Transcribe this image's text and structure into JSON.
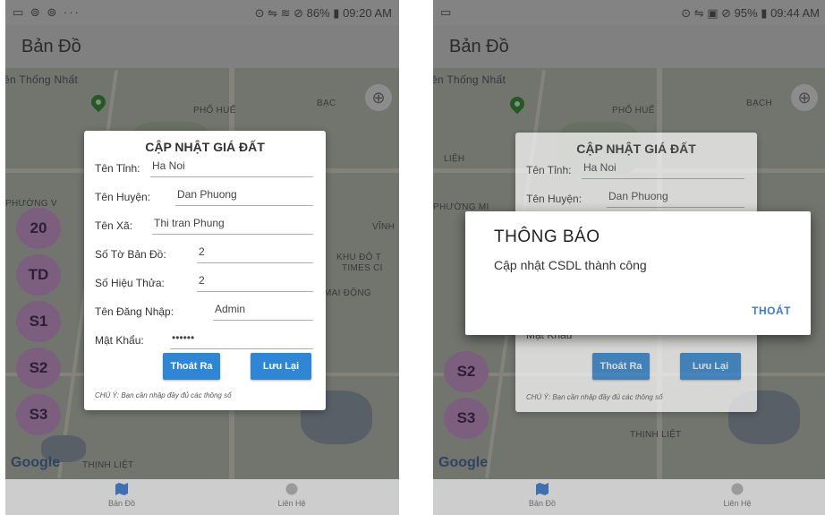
{
  "left_screen": {
    "status_bar": {
      "left_icons": "▭ ⊚ ⊚ ···",
      "right_text": "⊙ ⇋ ≋ ⊘ 86% ▮ 09:20 AM"
    },
    "app_title": "Bản Đồ",
    "map_labels": [
      "ên Thống Nhất",
      "PHỐ HUẾ",
      "BẠC",
      "PHƯỜNG V",
      "VĨNH",
      "KHU ĐÔ T",
      "TIMES CI",
      "MAI ĐỘNG",
      "THỊNH LIỆT"
    ],
    "fab_buttons": [
      "20",
      "TD",
      "S1",
      "S2",
      "S3"
    ],
    "google_logo": "Google",
    "form": {
      "title": "CẬP NHẬT GIÁ ĐẤT",
      "fields": [
        {
          "label": "Tên Tỉnh:",
          "value": "Ha Noi"
        },
        {
          "label": "Tên Huyện:",
          "value": "Dan Phuong"
        },
        {
          "label": "Tên Xã:",
          "value": "Thi tran Phung"
        },
        {
          "label": "Số Tờ Bản Đồ:",
          "value": "2"
        },
        {
          "label": "Số Hiệu Thửa:",
          "value": "2"
        },
        {
          "label": "Tên Đăng Nhập:",
          "value": "Admin"
        },
        {
          "label": "Mật Khẩu:",
          "value": "••••••"
        }
      ],
      "exit_button": "Thoát Ra",
      "save_button": "Lưu Lại",
      "note": "CHÚ Ý: Bạn cần nhập đầy đủ các thông số"
    },
    "bottom_nav": [
      "Bản Đồ",
      "Liên Hệ"
    ]
  },
  "right_screen": {
    "status_bar": {
      "left_icons": "▭",
      "right_text": "⊙ ⇋ ▣ ⊘ 95% ▮ 09:44 AM"
    },
    "app_title": "Bản Đồ",
    "map_labels": [
      "ên Thống Nhất",
      "PHỐ HUẾ",
      "BẠCH",
      "LIỆH",
      "PHƯỜNG MI",
      "THỊNH LIỆT"
    ],
    "fab_buttons": [
      "S2",
      "S3"
    ],
    "google_logo": "Google",
    "form": {
      "title": "CẬP NHẬT GIÁ ĐẤT",
      "fields": [
        {
          "label": "Tên Tỉnh:",
          "value": "Ha Noi"
        },
        {
          "label": "Tên Huyện:",
          "value": "Dan Phuong"
        }
      ],
      "hidden_label": "Mật Khẩu",
      "exit_button": "Thoát Ra",
      "save_button": "Lưu Lại",
      "note": "CHÚ Ý: Bạn cần nhập đầy đủ các thông số"
    },
    "alert": {
      "title": "THÔNG BÁO",
      "message": "Cập nhật CSDL thành công",
      "button": "THOÁT"
    },
    "bottom_nav": [
      "Bản Đồ",
      "Liên Hệ"
    ]
  },
  "colors": {
    "primary_button": "#2f86d4",
    "fab": "#c89acb",
    "alert_action": "#3a7bd5"
  }
}
